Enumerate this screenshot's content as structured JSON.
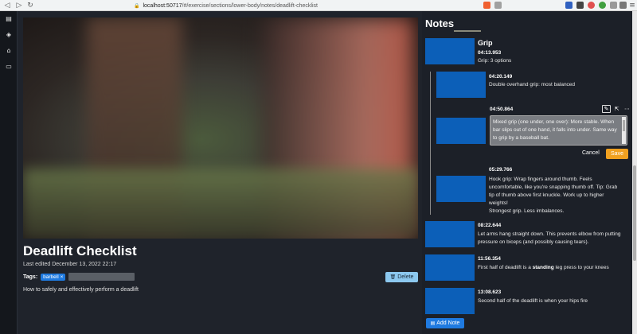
{
  "browser": {
    "back_icon": "back-arrow-icon",
    "forward_icon": "forward-arrow-icon",
    "reload_icon": "reload-icon",
    "url_host": "localhost:50717",
    "url_path": "/#/exercise/sections/lower-body/notes/deadlift-checklist"
  },
  "rail": {
    "items": [
      "notebook-icon",
      "tag-icon",
      "home-icon",
      "window-icon"
    ]
  },
  "main": {
    "title": "Deadlift Checklist",
    "last_edited": "Last edited December 13, 2022 22:17",
    "tags_label": "Tags:",
    "tags": [
      {
        "label": "barbell",
        "remove": "×"
      }
    ],
    "delete_label": "Delete",
    "description": "How to safely and effectively perform a deadlift"
  },
  "notes": {
    "title": "Notes",
    "items": [
      {
        "heading": "Grip",
        "timestamp": "04:13.953",
        "text": "Grip: 3 options"
      },
      {
        "timestamp": "04:20.149",
        "text": "Double overhand grip: most balanced"
      },
      {
        "timestamp": "04:50.864",
        "text": "Mixed grip (one under, one over): More stable. When bar slips out of one hand, it falls into under. Same way to grip by a baseball bat."
      },
      {
        "timestamp": "05:29.766",
        "text_lines": [
          "Hook grip: Wrap fingers around thumb. Feels",
          "uncomfortable, like you're snapping thumb off. Tip: Grab",
          "tip of thumb above first knuckle. Work up to higher",
          "weights!",
          "Strongest grip. Less imbalances."
        ]
      },
      {
        "timestamp": "08:22.644",
        "text_lines": [
          "Let arms hang straight down. This prevents elbow from putting",
          "pressure on biceps (and possibly causing tears)."
        ]
      },
      {
        "timestamp": "11:56.354",
        "text_pre": "First half of deadlift is a ",
        "text_strong": "standing",
        "text_post": " leg press to your knees"
      },
      {
        "timestamp": "13:08.623",
        "text": "Second half of the deadlift is when your hips fire"
      }
    ],
    "cancel_label": "Cancel",
    "save_label": "Save",
    "add_note_label": "Add Note"
  },
  "colors": {
    "accent": "#1f7ae0",
    "save": "#f0a020",
    "delete": "#8cc8ef",
    "thumbnail": "#0c5fb8"
  }
}
